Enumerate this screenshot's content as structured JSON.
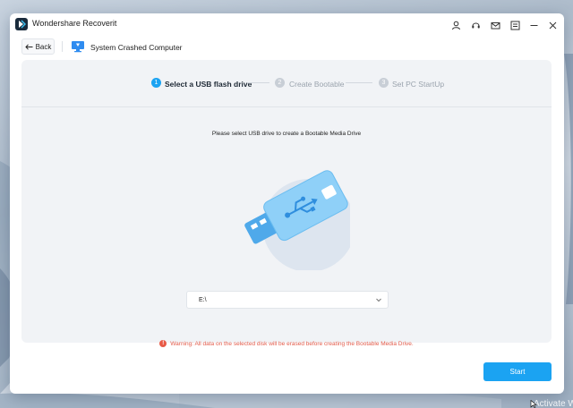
{
  "window": {
    "title": "Wondershare Recoverit"
  },
  "titlebar_icons": [
    "user-icon",
    "headset-icon",
    "mail-icon",
    "menu-icon",
    "minimize-icon",
    "close-icon"
  ],
  "header": {
    "back_label": "Back",
    "page_title": "System Crashed Computer"
  },
  "steps": [
    {
      "number": "1",
      "label": "Select a USB flash drive",
      "active": true
    },
    {
      "number": "2",
      "label": "Create Bootable",
      "active": false
    },
    {
      "number": "3",
      "label": "Set PC StartUp",
      "active": false
    }
  ],
  "main": {
    "instruction": "Please select USB drive to create a Bootable Media Drive",
    "drive_select_value": "E:\\",
    "warning": "Warning: All data on the selected disk will be erased before creating the Bootable Media Drive."
  },
  "footer": {
    "start_label": "Start"
  },
  "desktop": {
    "activate_text": "Activate Wi"
  },
  "colors": {
    "accent": "#1ba3f2",
    "warning": "#e35b4a",
    "panel_bg": "#f1f3f6"
  }
}
